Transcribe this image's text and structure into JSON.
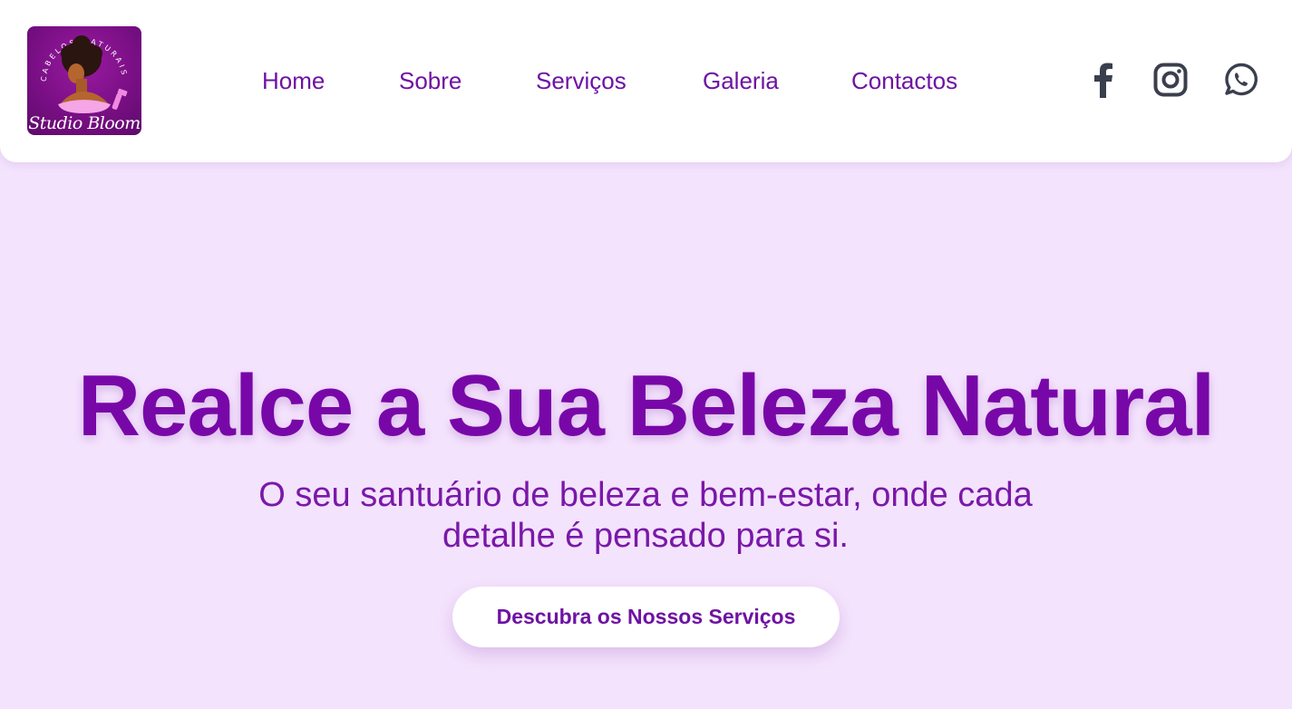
{
  "brand": {
    "logo_top_text": "CABELOS NATURAIS",
    "logo_script_text": "Studio Bloom"
  },
  "nav": {
    "items": [
      {
        "label": "Home"
      },
      {
        "label": "Sobre"
      },
      {
        "label": "Serviços"
      },
      {
        "label": "Galeria"
      },
      {
        "label": "Contactos"
      }
    ]
  },
  "social": {
    "icons": [
      "facebook-icon",
      "instagram-icon",
      "whatsapp-icon"
    ],
    "icon_color": "#3a3f4e"
  },
  "hero": {
    "title": "Realce a Sua Beleza Natural",
    "subtitle": "O seu santuário de beleza e bem-estar, onde cada detalhe é pensado para si.",
    "cta_label": "Descubra os Nossos Serviços"
  },
  "colors": {
    "background": "#f4e3fd",
    "accent": "#7807a8",
    "header_bg": "#ffffff"
  }
}
